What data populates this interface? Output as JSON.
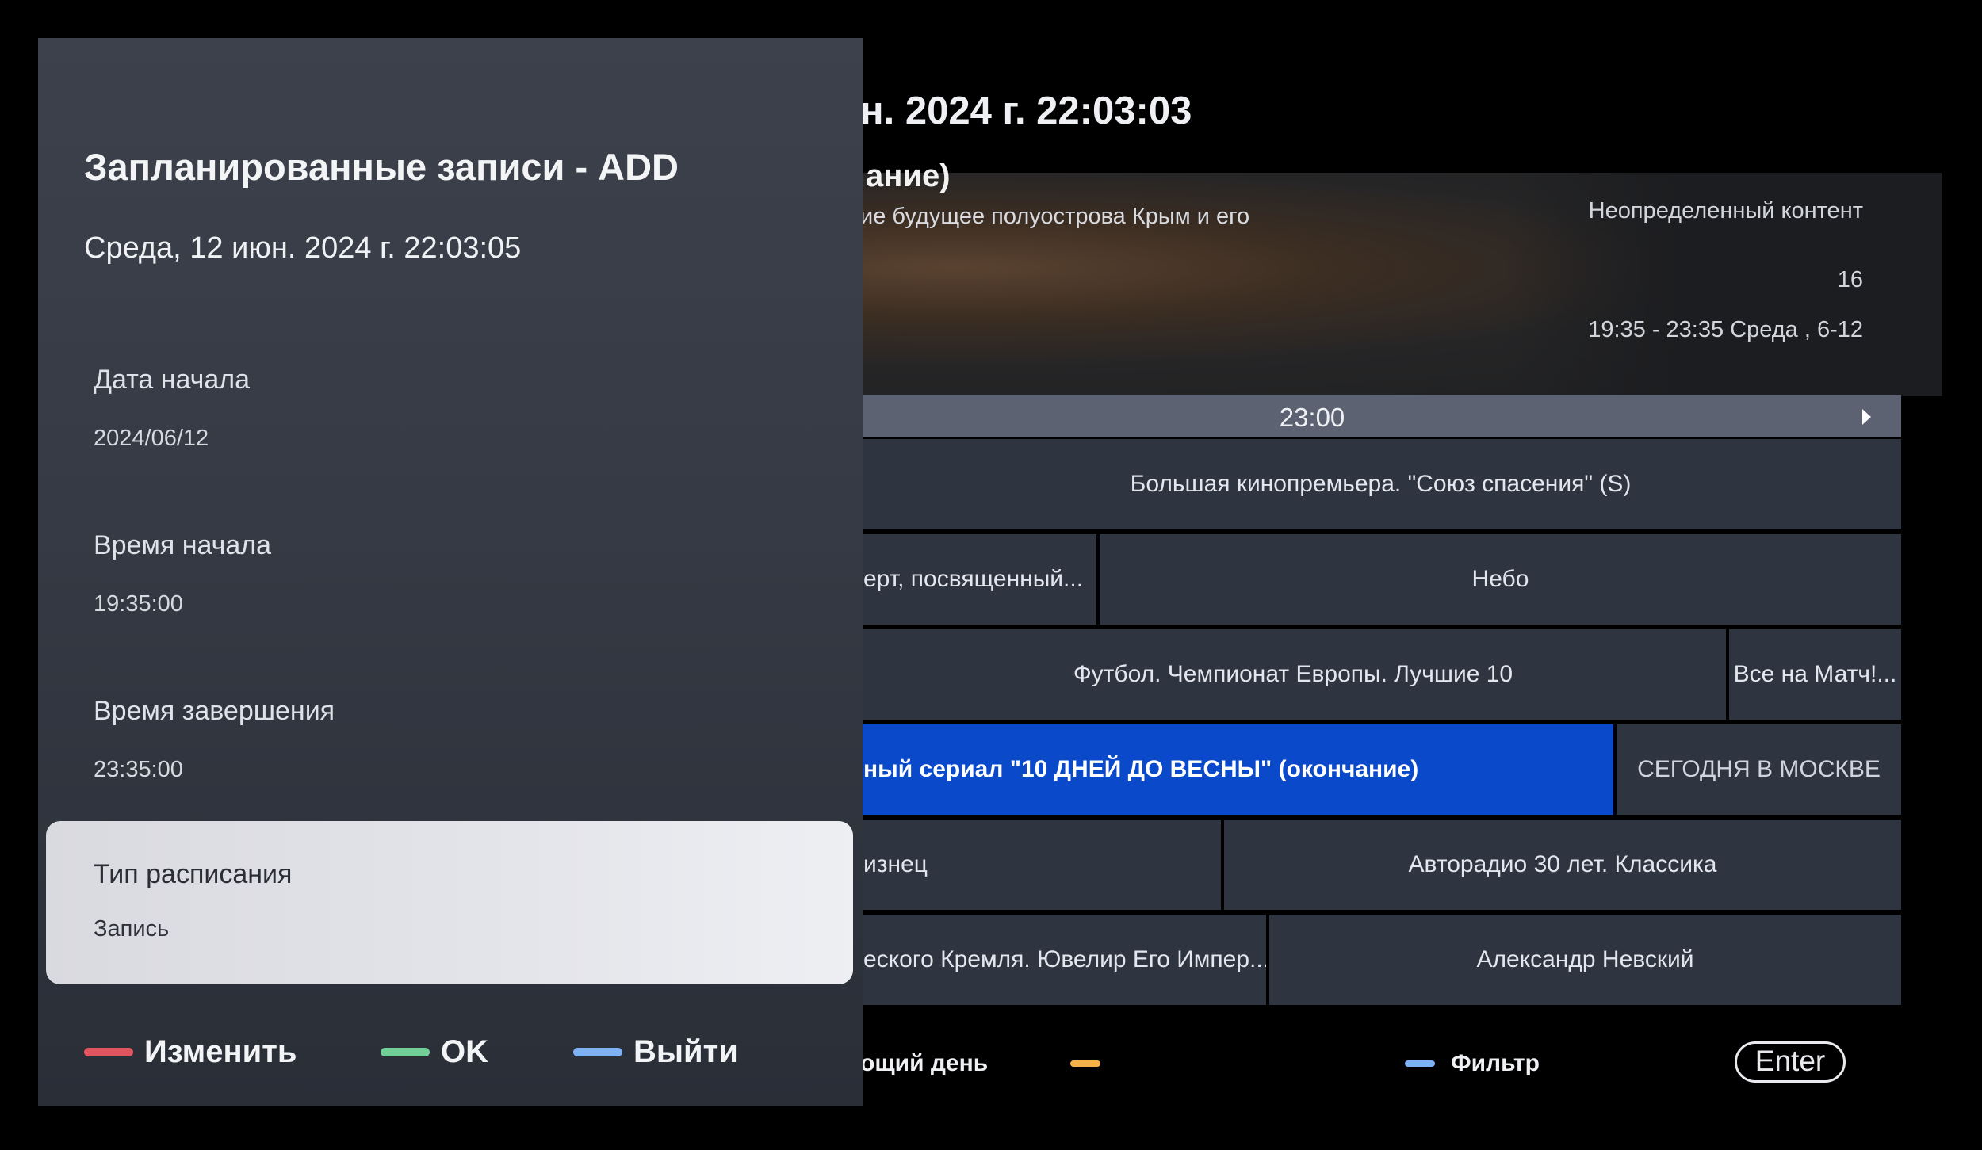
{
  "epg": {
    "clock": "н. 2024 г. 22:03:03",
    "preview": {
      "title": "ание)",
      "description": "ие будущее полуострова Крым и его",
      "genre": "Неопределенный контент",
      "age": "16",
      "time": "19:35 - 23:35   Среда , 6-12"
    },
    "timebar": {
      "label": "23:00"
    },
    "rows": [
      {
        "cells": [
          {
            "text": "Большая кинопремьера. \"Союз спасения\" (S)"
          }
        ]
      },
      {
        "cells": [
          {
            "text": "ерт, посвященный..."
          },
          {
            "text": "Небо"
          }
        ]
      },
      {
        "cells": [
          {
            "text": "Футбол. Чемпионат Европы. Лучшие 10"
          },
          {
            "text": "Все на Матч!..."
          }
        ]
      },
      {
        "cells": [
          {
            "text": "ный сериал \"10 ДНЕЙ ДО ВЕСНЫ\" (окончание)"
          },
          {
            "text": "СЕГОДНЯ В МОСКВЕ"
          }
        ]
      },
      {
        "cells": [
          {
            "text": "изнец"
          },
          {
            "text": "Авторадио  30 лет. Классика"
          }
        ]
      },
      {
        "cells": [
          {
            "text": "еского Кремля. Ювелир Его Импер..."
          },
          {
            "text": "Александр Невский"
          }
        ]
      }
    ],
    "legend": {
      "next_day": "ощий день",
      "yellow": "",
      "filter": "Фильтр",
      "enter": "Enter"
    }
  },
  "panel": {
    "title": "Запланированные записи - ADD",
    "date": "Среда,  12 июн. 2024 г. 22:03:05",
    "fields": [
      {
        "label": "Дата начала",
        "value": "2024/06/12"
      },
      {
        "label": "Время начала",
        "value": "19:35:00"
      },
      {
        "label": "Время завершения",
        "value": "23:35:00"
      },
      {
        "label": "Тип расписания",
        "value": "Запись"
      }
    ],
    "legend": {
      "edit": "Изменить",
      "ok": "OK",
      "exit": "Выйти"
    }
  },
  "colors": {
    "red": "#e0555e",
    "green": "#6fcf97",
    "blue": "#7fb2f5",
    "yellow": "#f5b14a",
    "selected": "#0a49c9"
  }
}
